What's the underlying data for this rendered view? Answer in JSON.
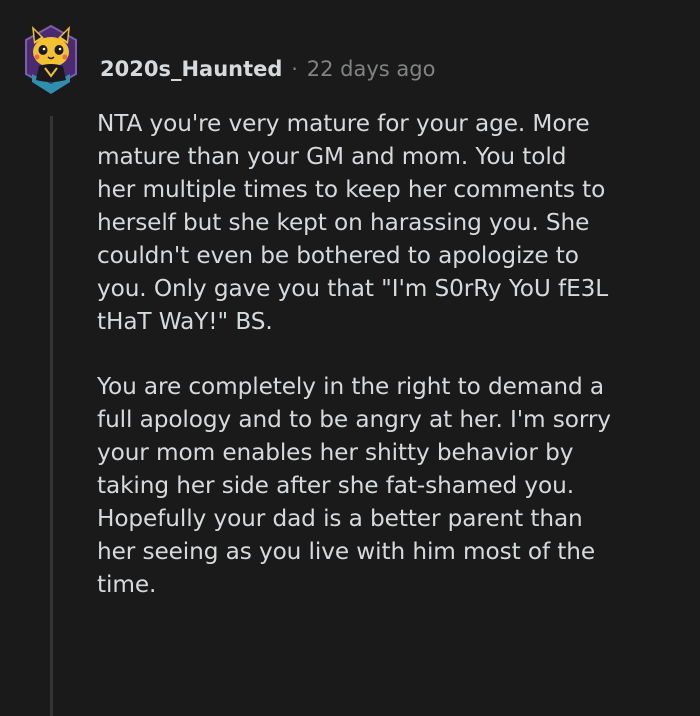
{
  "comment": {
    "author": "2020s_Haunted",
    "separator": "·",
    "timestamp": "22 days ago",
    "avatar_icon": "snoo-avatar-icon",
    "paragraphs": [
      [
        "NTA you're very mature for your age. More",
        "mature than your GM and mom. You told",
        "her multiple times to keep her comments to",
        "herself but she kept on harassing you. She",
        "couldn't even be bothered to apologize to",
        "you. Only gave you that \"I'm S0rRy YoU fE3L",
        "tHaT WaY!\" BS."
      ],
      [
        "You are completely in the right to demand a",
        "full apology and to be angry at her. I'm sorry",
        "your mom enables her shitty behavior by",
        "taking her side after she fat-shamed you.",
        "Hopefully your dad is a better parent than",
        "her seeing as you live with him most of the",
        "time."
      ]
    ]
  },
  "colors": {
    "background": "#1a1a1b",
    "text": "#d7dadc",
    "meta": "#818384",
    "thread_line": "#343536",
    "avatar_yellow": "#f2c230",
    "avatar_purple": "#4b2a73"
  }
}
